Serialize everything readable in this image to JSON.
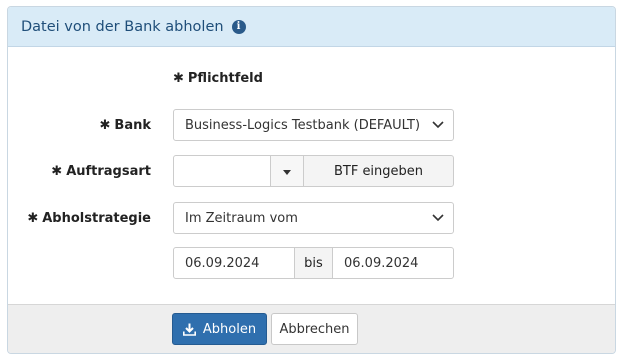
{
  "panel": {
    "title": "Datei von der Bank abholen"
  },
  "form": {
    "required_note": "Pflichtfeld",
    "required_marker": "✱",
    "bank": {
      "label": "Bank",
      "value": "Business-Logics Testbank (DEFAULT)"
    },
    "auftragsart": {
      "label": "Auftragsart",
      "value": "",
      "button_label": "BTF eingeben"
    },
    "abholstrategie": {
      "label": "Abholstrategie",
      "value": "Im Zeitraum vom"
    },
    "zeitraum": {
      "from": "06.09.2024",
      "separator": "bis",
      "to": "06.09.2024"
    }
  },
  "footer": {
    "submit_label": "Abholen",
    "cancel_label": "Abbrechen"
  },
  "colors": {
    "primary": "#2f6fae",
    "header_bg": "#d9ebf7",
    "footer_bg": "#eeeeee"
  }
}
